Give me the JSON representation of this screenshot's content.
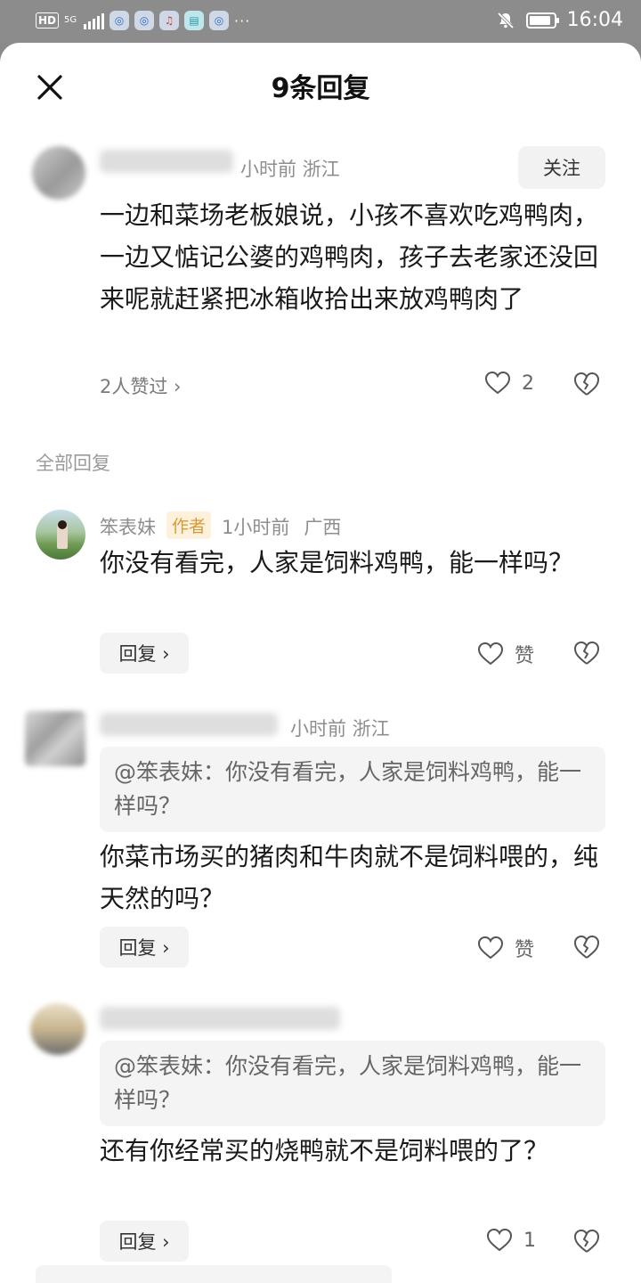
{
  "status_bar": {
    "network_hd": "HD",
    "network_5g": "5G",
    "app_icons": [
      "browser",
      "browser",
      "music",
      "reader",
      "browser"
    ],
    "more": "···",
    "time": "16:04",
    "battery_level": 0.9
  },
  "header": {
    "title": "9条回复"
  },
  "main_comment": {
    "meta": "小时前  浙江",
    "follow_label": "关注",
    "text": "一边和菜场老板娘说，小孩不喜欢吃鸡鸭肉，一边又惦记公婆的鸡鸭肉，孩子去老家还没回来呢就赶紧把冰箱收拾出来放鸡鸭肉了",
    "likes_summary": "2人赞过 ›",
    "like_count": "2"
  },
  "section_label": "全部回复",
  "replies": [
    {
      "name": "笨表妹",
      "tag": "作者",
      "time": "1小时前",
      "location": "广西",
      "text": "你没有看完，人家是饲料鸡鸭，能一样吗？",
      "reply_label": "回复 ›",
      "like_label": "赞"
    },
    {
      "meta": "小时前  浙江",
      "quote": "@笨表妹：你没有看完，人家是饲料鸡鸭，能一样吗？",
      "text": "你菜市场买的猪肉和牛肉就不是饲料喂的，纯天然的吗？",
      "reply_label": "回复 ›",
      "like_label": "赞"
    },
    {
      "quote": "@笨表妹：你没有看完，人家是饲料鸡鸭，能一样吗？",
      "text": "还有你经常买的烧鸭就不是饲料喂的了？",
      "reply_label": "回复 ›",
      "like_count": "1"
    }
  ],
  "colors": {
    "status_bg": "#8c8c8c",
    "author_tag_bg": "#fdf1db",
    "author_tag_fg": "#d49a3c"
  }
}
